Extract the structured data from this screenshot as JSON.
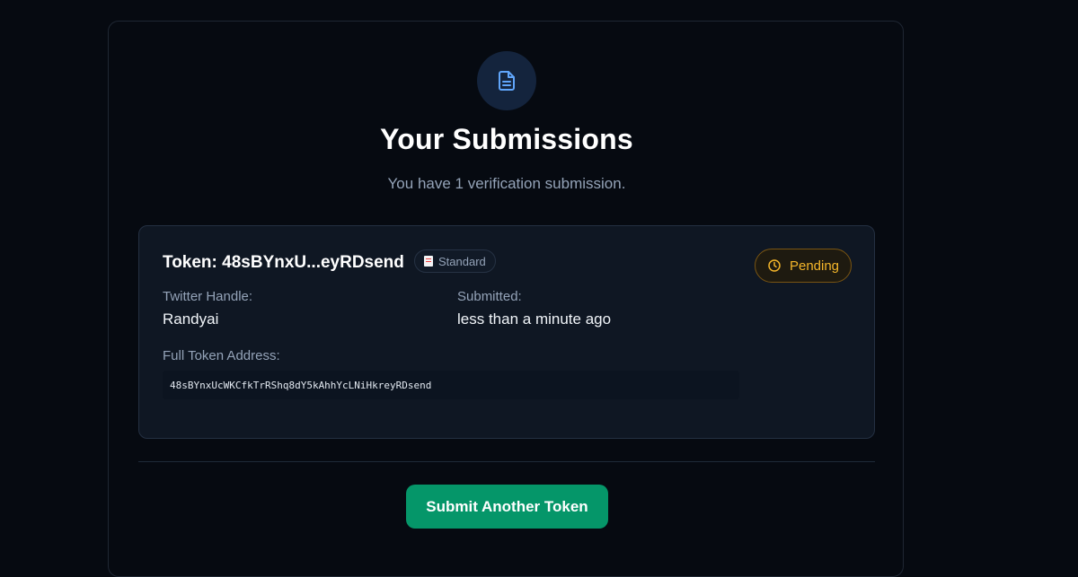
{
  "header": {
    "icon": "document-icon",
    "title": "Your Submissions",
    "subtitle": "You have 1 verification submission."
  },
  "submission": {
    "title": "Token: 48sBYnxU...eyRDsend",
    "type_badge": {
      "icon": "receipt-icon",
      "label": "Standard"
    },
    "status": {
      "icon": "clock-icon",
      "label": "Pending",
      "color": "#f5b62a"
    },
    "twitter_handle_label": "Twitter Handle:",
    "twitter_handle_value": "Randyai",
    "submitted_label": "Submitted:",
    "submitted_value": "less than a minute ago",
    "full_address_label": "Full Token Address:",
    "full_address_value": "48sBYnxUcWKCfkTrRShq8dY5kAhhYcLNiHkreyRDsend"
  },
  "actions": {
    "submit_another_label": "Submit Another Token",
    "accent_color": "#059669"
  }
}
